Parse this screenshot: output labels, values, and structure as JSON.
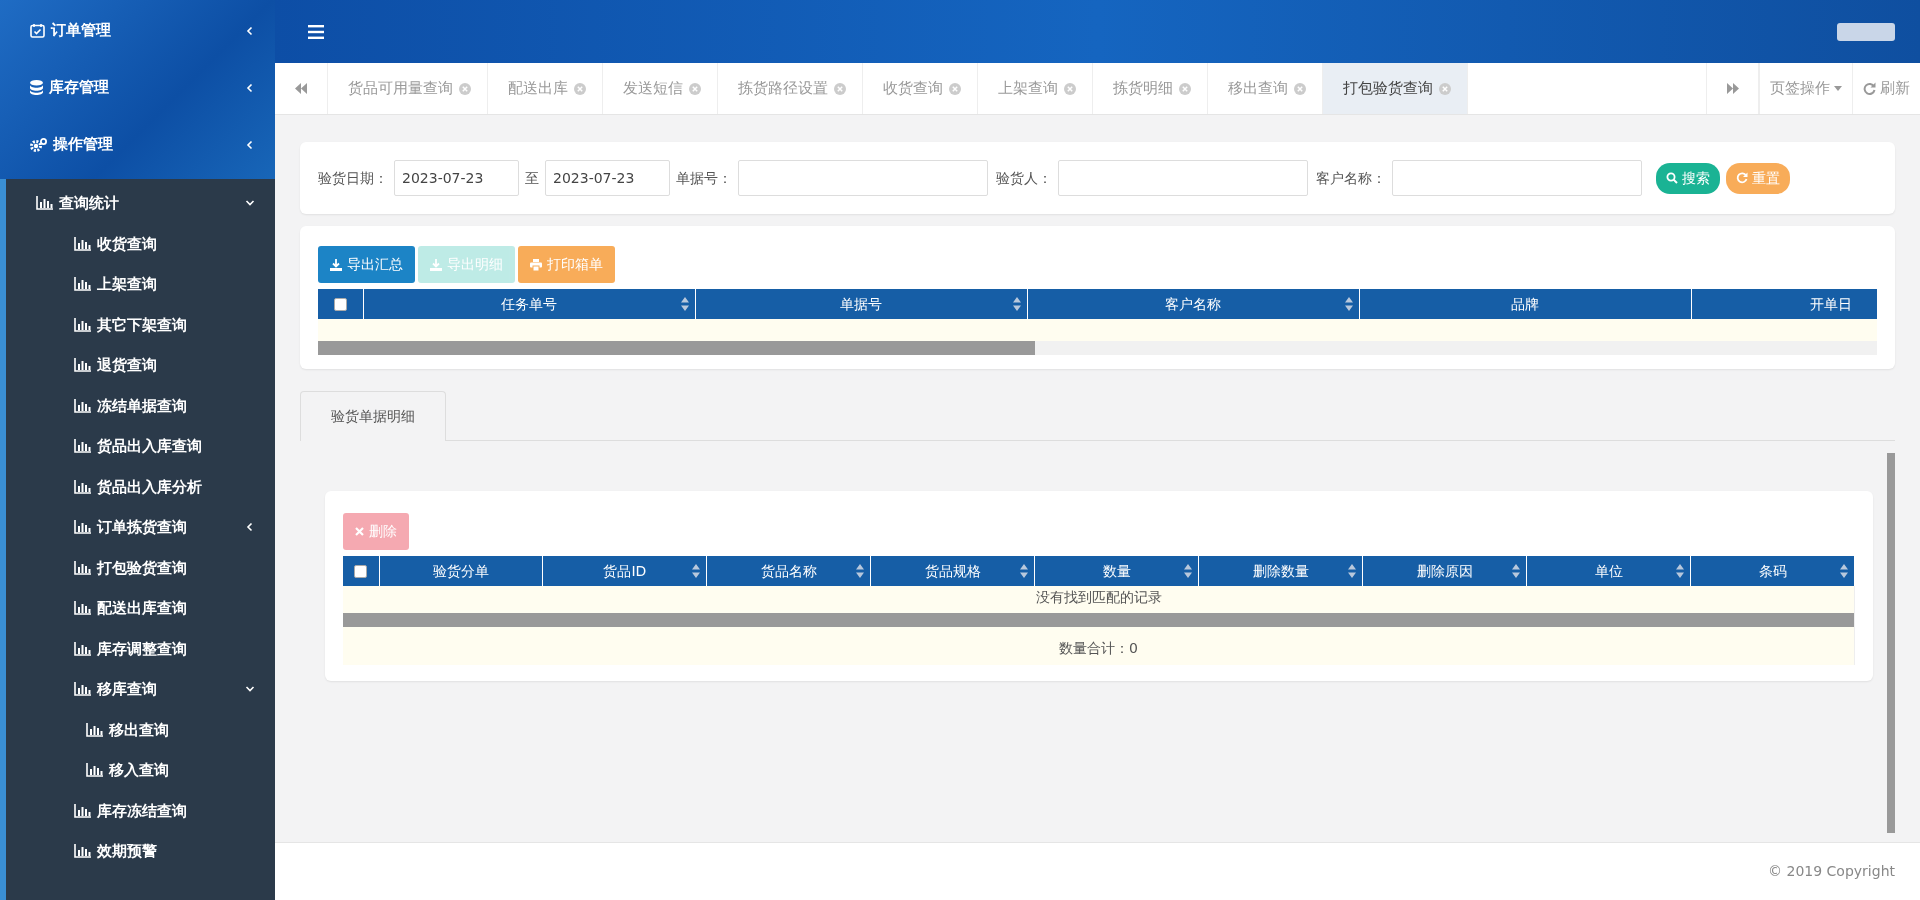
{
  "sidebar": {
    "items": [
      {
        "label": "订单管理",
        "expanded": false
      },
      {
        "label": "库存管理",
        "expanded": false
      },
      {
        "label": "操作管理",
        "expanded": false
      },
      {
        "label": "查询统计",
        "expanded": true,
        "children": [
          {
            "label": "收货查询"
          },
          {
            "label": "上架查询"
          },
          {
            "label": "其它下架查询"
          },
          {
            "label": "退货查询"
          },
          {
            "label": "冻结单据查询"
          },
          {
            "label": "货品出入库查询"
          },
          {
            "label": "货品出入库分析"
          },
          {
            "label": "订单拣货查询",
            "expanded": false
          },
          {
            "label": "打包验货查询"
          },
          {
            "label": "配送出库查询"
          },
          {
            "label": "库存调整查询"
          },
          {
            "label": "移库查询",
            "expanded": true,
            "children": [
              {
                "label": "移出查询"
              },
              {
                "label": "移入查询"
              }
            ]
          },
          {
            "label": "库存冻结查询"
          },
          {
            "label": "效期预警"
          }
        ]
      }
    ]
  },
  "tabs": [
    {
      "label": "货品可用量查询",
      "selected": false
    },
    {
      "label": "配送出库",
      "selected": false
    },
    {
      "label": "发送短信",
      "selected": false
    },
    {
      "label": "拣货路径设置",
      "selected": false
    },
    {
      "label": "收货查询",
      "selected": false
    },
    {
      "label": "上架查询",
      "selected": false
    },
    {
      "label": "拣货明细",
      "selected": false
    },
    {
      "label": "移出查询",
      "selected": false
    },
    {
      "label": "打包验货查询",
      "selected": true
    }
  ],
  "tab_tools": {
    "menu_label": "页签操作",
    "refresh_label": "刷新"
  },
  "search": {
    "date_label": "验货日期：",
    "date_from": "2023-07-23",
    "separator": "至",
    "date_to": "2023-07-23",
    "fields": [
      {
        "label": "单据号："
      },
      {
        "label": "验货人："
      },
      {
        "label": "客户名称："
      }
    ],
    "buttons": [
      {
        "label": "搜索",
        "kind": "search"
      },
      {
        "label": "重置",
        "kind": "reset"
      }
    ]
  },
  "toolbar": [
    {
      "label": "导出汇总",
      "kind": "export",
      "disabled": false
    },
    {
      "label": "导出明细",
      "kind": "export",
      "disabled": true
    },
    {
      "label": "打印箱单",
      "kind": "print",
      "disabled": false
    }
  ],
  "main_table": {
    "select_all": {
      "checked": false
    },
    "columns": [
      {
        "label": "任务单号",
        "sortable": true
      },
      {
        "label": "单据号",
        "sortable": true
      },
      {
        "label": "客户名称",
        "sortable": true
      },
      {
        "label": "品牌",
        "sortable": false
      },
      {
        "label": "开单日"
      }
    ]
  },
  "detail_tabs": [
    {
      "label": "验货单据明细",
      "selected": true
    }
  ],
  "detail": {
    "select_all": {
      "checked": false
    },
    "delete_button": {
      "label": "删除",
      "disabled": true
    },
    "columns": [
      {
        "label": "验货分单",
        "sortable": false
      },
      {
        "label": "货品ID",
        "sortable": true
      },
      {
        "label": "货品名称",
        "sortable": true
      },
      {
        "label": "货品规格",
        "sortable": true
      },
      {
        "label": "数量",
        "sortable": true
      },
      {
        "label": "删除数量",
        "sortable": true
      },
      {
        "label": "删除原因",
        "sortable": true
      },
      {
        "label": "单位",
        "sortable": true
      },
      {
        "label": "条码",
        "sortable": true
      }
    ],
    "empty_message": "没有找到匹配的记录",
    "total": "数量合计：0"
  },
  "footer": {
    "copyright": "© 2019 Copyright"
  }
}
